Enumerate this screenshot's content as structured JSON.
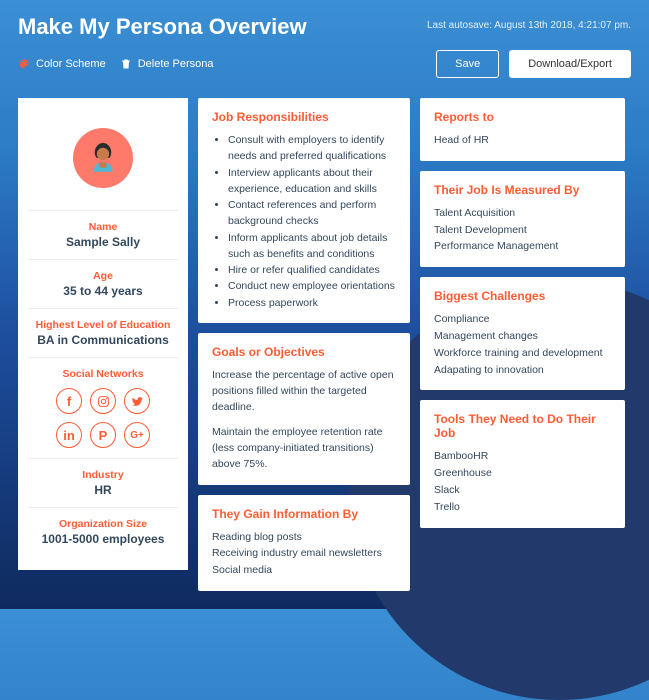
{
  "header": {
    "title": "Make My Persona Overview",
    "autosave": "Last autosave: August 13th 2018, 4:21:07 pm.",
    "color_scheme": "Color Scheme",
    "delete_persona": "Delete Persona",
    "save": "Save",
    "download": "Download/Export"
  },
  "persona": {
    "name_label": "Name",
    "name": "Sample Sally",
    "age_label": "Age",
    "age": "35 to 44 years",
    "education_label": "Highest Level of Education",
    "education": "BA in Communications",
    "social_label": "Social Networks",
    "industry_label": "Industry",
    "industry": "HR",
    "orgsize_label": "Organization Size",
    "orgsize": "1001-5000 employees"
  },
  "responsibilities": {
    "heading": "Job Responsibilities",
    "items": [
      "Consult with employers to identify needs and preferred qualifications",
      "Interview applicants about their experience, education and skills",
      "Contact references and perform background checks",
      "Inform applicants about job details such as benefits and conditions",
      "Hire or refer qualified candidates",
      "Conduct new employee orientations",
      "Process paperwork"
    ]
  },
  "reports": {
    "heading": "Reports to",
    "value": "Head of HR"
  },
  "measured": {
    "heading": "Their Job Is Measured By",
    "items": [
      "Talent Acquisition",
      "Talent Development",
      "Performance Management"
    ]
  },
  "goals": {
    "heading": "Goals or Objectives",
    "p1": "Increase the percentage of active open positions filled within the targeted deadline.",
    "p2": "Maintain the employee retention rate (less company-initiated transitions) above 75%."
  },
  "challenges": {
    "heading": "Biggest Challenges",
    "items": [
      "Compliance",
      "Management changes",
      "Workforce training and development",
      "Adapating to innovation"
    ]
  },
  "info": {
    "heading": "They Gain Information By",
    "items": [
      "Reading blog posts",
      "Receiving industry email newsletters",
      "Social media"
    ]
  },
  "tools": {
    "heading": "Tools They Need to Do Their Job",
    "items": [
      "BambooHR",
      "Greenhouse",
      "Slack",
      "Trello"
    ]
  }
}
